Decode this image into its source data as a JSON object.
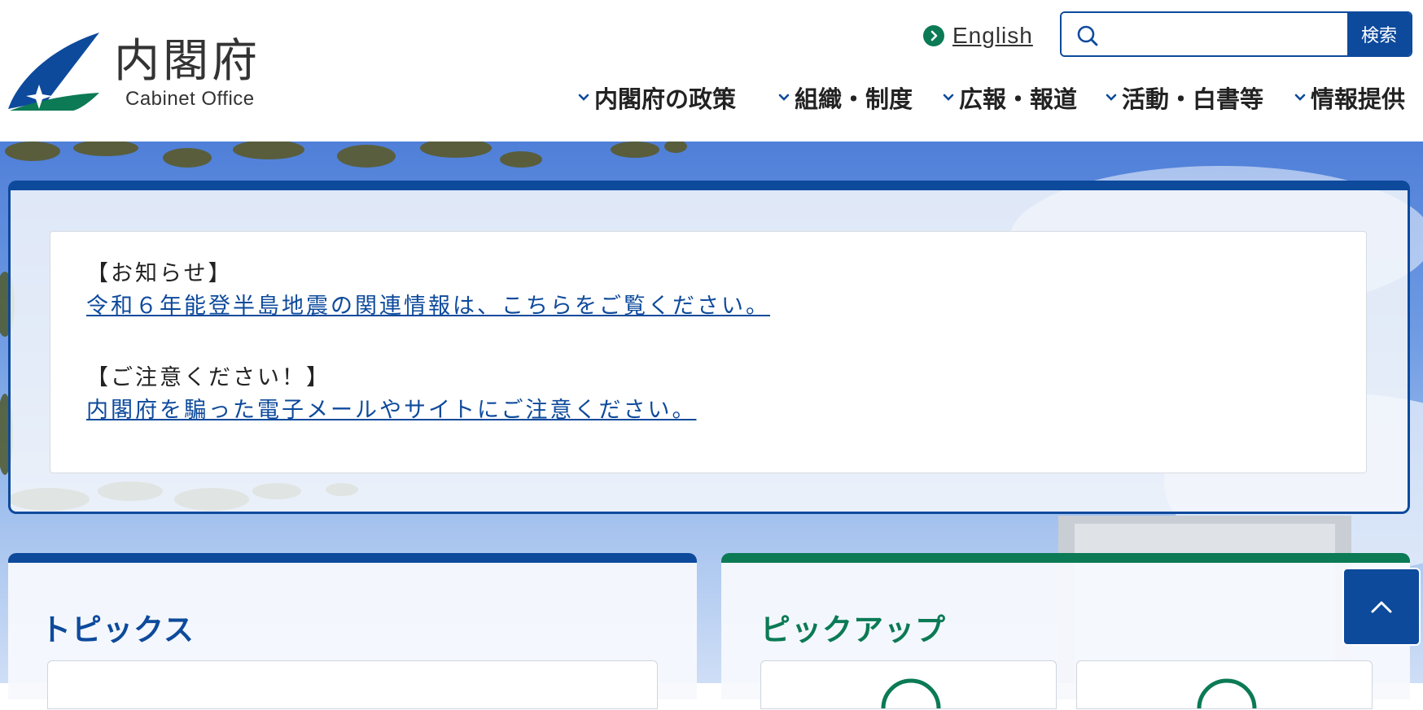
{
  "header": {
    "logo_ja": "内閣府",
    "logo_en": "Cabinet Office",
    "english_label": "English",
    "search": {
      "placeholder": "",
      "value": "",
      "button_label": "検索"
    },
    "nav": [
      {
        "label": "内閣府の政策"
      },
      {
        "label": "組織・制度"
      },
      {
        "label": "広報・報道"
      },
      {
        "label": "活動・白書等"
      },
      {
        "label": "情報提供"
      }
    ]
  },
  "notice": {
    "items": [
      {
        "heading": "【お知らせ】",
        "link": "令和６年能登半島地震の関連情報は、こちらをご覧ください。"
      },
      {
        "heading": "【ご注意ください！】",
        "link": "内閣府を騙った電子メールやサイトにご注意ください。"
      }
    ]
  },
  "topics": {
    "title": "トピックス"
  },
  "pickup": {
    "title": "ピックアップ"
  },
  "colors": {
    "primary": "#0d4a9c",
    "green": "#0b7a55",
    "chevron": "#0d4a9c"
  }
}
